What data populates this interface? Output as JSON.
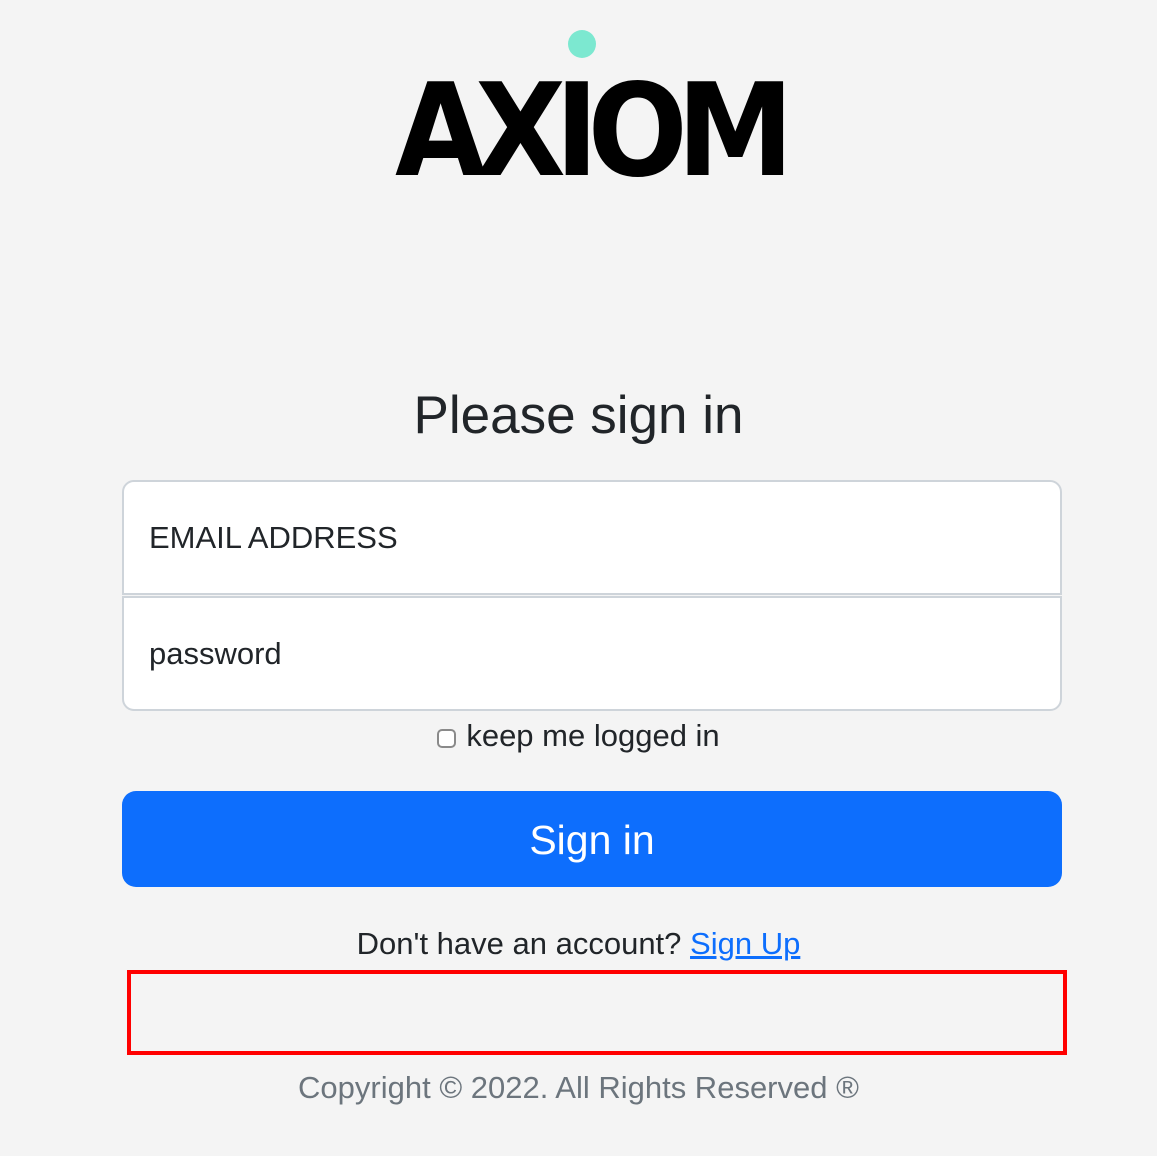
{
  "brand": {
    "logo_text": "AXIOM",
    "accent_dot_color": "#7ce8d0"
  },
  "form": {
    "title": "Please sign in",
    "email_placeholder": "EMAIL ADDRESS",
    "email_value": "",
    "password_placeholder": "password",
    "password_value": "",
    "remember_label": "keep me logged in",
    "remember_checked": false,
    "submit_label": "Sign in",
    "submit_color": "#0d6efd"
  },
  "signup": {
    "prompt": "Don't have an account? ",
    "link_label": "Sign Up",
    "link_color": "#0d6efd"
  },
  "footer": {
    "copyright": "Copyright © 2022. All Rights Reserved ®"
  }
}
